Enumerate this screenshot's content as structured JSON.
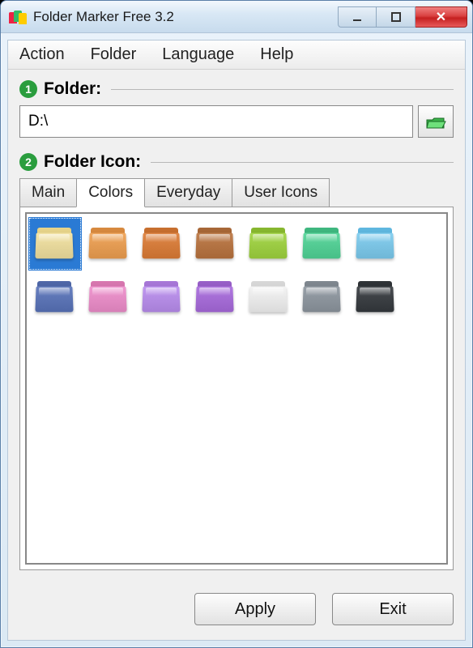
{
  "window": {
    "title": "Folder Marker Free 3.2"
  },
  "menubar": {
    "items": [
      "Action",
      "Folder",
      "Language",
      "Help"
    ]
  },
  "step1": {
    "num": "1",
    "label": "Folder:"
  },
  "path": {
    "value": "D:\\"
  },
  "step2": {
    "num": "2",
    "label": "Folder Icon:"
  },
  "tabs": {
    "items": [
      {
        "label": "Main",
        "active": false
      },
      {
        "label": "Colors",
        "active": true
      },
      {
        "label": "Everyday",
        "active": false
      },
      {
        "label": "User Icons",
        "active": false
      }
    ]
  },
  "icons": {
    "row1": [
      {
        "name": "yellow",
        "back": "#e7d48a",
        "front": "#f3e4a8",
        "selected": true
      },
      {
        "name": "orange",
        "back": "#d88a40",
        "front": "#f0a860"
      },
      {
        "name": "dark-orange",
        "back": "#c87030",
        "front": "#e08848"
      },
      {
        "name": "brown",
        "back": "#a86838",
        "front": "#c08050"
      },
      {
        "name": "green",
        "back": "#88b830",
        "front": "#a8d850"
      },
      {
        "name": "teal",
        "back": "#40b880",
        "front": "#60d8a0"
      },
      {
        "name": "light-blue",
        "back": "#60b8e0",
        "front": "#88d0f0"
      }
    ],
    "row2": [
      {
        "name": "dark-blue",
        "back": "#5068a8",
        "front": "#6880c0"
      },
      {
        "name": "pink",
        "back": "#d878b0",
        "front": "#f098d0"
      },
      {
        "name": "violet",
        "back": "#a878d8",
        "front": "#c098f0"
      },
      {
        "name": "purple",
        "back": "#9860c8",
        "front": "#b078e0"
      },
      {
        "name": "white",
        "back": "#d8d8d8",
        "front": "#f4f4f4"
      },
      {
        "name": "gray",
        "back": "#808890",
        "front": "#98a0a8"
      },
      {
        "name": "black",
        "back": "#303438",
        "front": "#484c50"
      }
    ]
  },
  "buttons": {
    "apply": "Apply",
    "exit": "Exit"
  }
}
